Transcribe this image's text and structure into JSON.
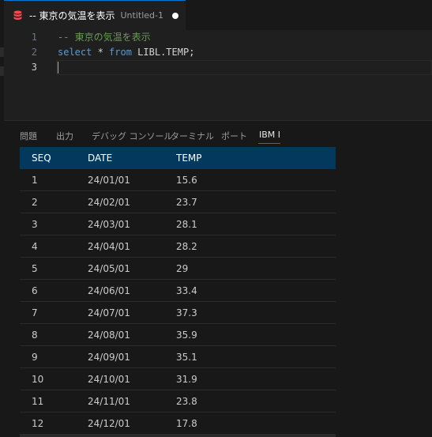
{
  "tab": {
    "title": "-- 東京の気温を表示",
    "description": "Untitled-1",
    "icon": "database-icon"
  },
  "editor": {
    "lines": [
      {
        "number": "1",
        "comment": "-- 東京の気温を表示"
      },
      {
        "number": "2",
        "kw1": "select",
        "mid": " * ",
        "kw2": "from",
        "rest": " LIBL.TEMP;"
      },
      {
        "number": "3"
      }
    ]
  },
  "panel": {
    "tabs": [
      {
        "label": "問題"
      },
      {
        "label": "出力"
      },
      {
        "label": "デバッグ コンソール"
      },
      {
        "label": "ターミナル"
      },
      {
        "label": "ポート"
      },
      {
        "label": "IBM I"
      }
    ],
    "active_tab": "IBM I"
  },
  "results": {
    "columns": [
      "SEQ",
      "DATE",
      "TEMP"
    ],
    "rows": [
      [
        "1",
        "24/01/01",
        "15.6"
      ],
      [
        "2",
        "24/02/01",
        "23.7"
      ],
      [
        "3",
        "24/03/01",
        "28.1"
      ],
      [
        "4",
        "24/04/01",
        "28.2"
      ],
      [
        "5",
        "24/05/01",
        "29"
      ],
      [
        "6",
        "24/06/01",
        "33.4"
      ],
      [
        "7",
        "24/07/01",
        "37.3"
      ],
      [
        "8",
        "24/08/01",
        "35.9"
      ],
      [
        "9",
        "24/09/01",
        "35.1"
      ],
      [
        "10",
        "24/10/01",
        "31.9"
      ],
      [
        "11",
        "24/11/01",
        "23.8"
      ],
      [
        "12",
        "24/12/01",
        "17.8"
      ]
    ]
  },
  "colors": {
    "accent": "#0078d4",
    "header_bg": "#04395e",
    "comment": "#6a9955",
    "keyword": "#569cd6",
    "icon": "#f14c4c"
  }
}
